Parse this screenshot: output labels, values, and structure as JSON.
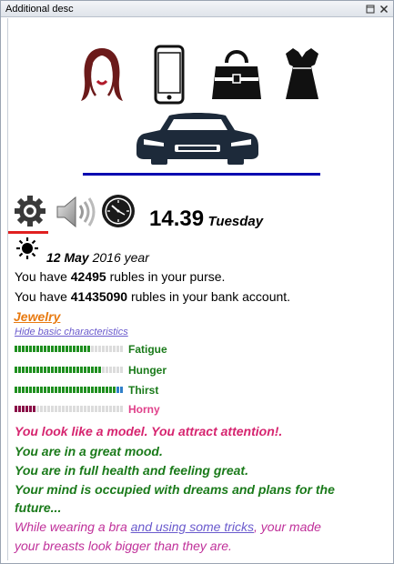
{
  "window": {
    "title": "Additional desc"
  },
  "icons": {
    "hair": "hair-icon",
    "phone": "phone-icon",
    "bag": "handbag-icon",
    "dress": "dress-icon",
    "car": "car-icon",
    "settings": "gear-icon",
    "sound": "speaker-icon",
    "clock": "clock-icon",
    "weather": "sun-icon"
  },
  "time": {
    "value": "14.39",
    "weekday": "Tuesday"
  },
  "date": {
    "day_month": "12 May",
    "year": "2016 year"
  },
  "money": {
    "purse_prefix": "You have ",
    "purse_amount": "42495",
    "purse_suffix": " rubles in your purse.",
    "bank_prefix": "You have ",
    "bank_amount": "41435090",
    "bank_suffix": " rubles in your bank account."
  },
  "links": {
    "jewelry": "Jewelry",
    "hide_characteristics": "Hide basic characteristics"
  },
  "stats": [
    {
      "label": "Fatigue",
      "level": 0.7,
      "fill": "#1f8f1f",
      "label_color": "#1a7a1a"
    },
    {
      "label": "Hunger",
      "level": 0.8,
      "fill": "#1f8f1f",
      "label_color": "#1a7a1a"
    },
    {
      "label": "Thirst",
      "level": 1.0,
      "fill": "#1f8f1f",
      "end_fill": "#2f7fc8",
      "label_color": "#1a7a1a"
    },
    {
      "label": "Horny",
      "level": 0.2,
      "fill": "#8a1048",
      "label_color": "#e0408a"
    }
  ],
  "messages": {
    "look": "You look like a model. You attract attention!.",
    "mood": "You are in a great mood.",
    "health": "You are in full health and feeling great.",
    "mind_1": "Your mind is occupied with dreams and plans for the",
    "mind_2": "future...",
    "bra_1a": "While wearing a bra ",
    "bra_link": "and using some tricks",
    "bra_1b": ", your made",
    "bra_2": "your breasts look bigger than they are."
  },
  "colors": {
    "pink": "#d6246f",
    "green": "#1a7a1a",
    "link_orange": "#e87a10",
    "link_purple": "#6a5acd",
    "light_pink": "#c0309a",
    "accent_red": "#e02020",
    "accent_blue": "#0000b0"
  }
}
